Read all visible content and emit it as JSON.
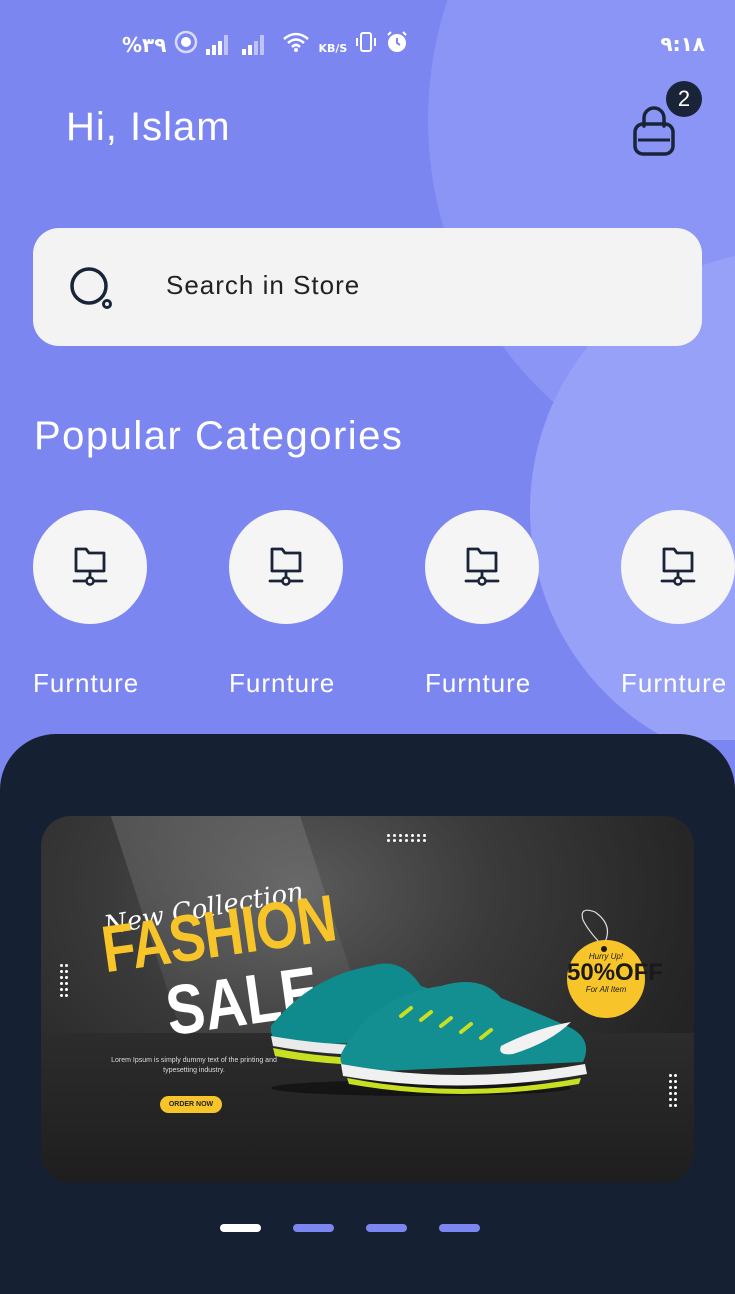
{
  "status_bar": {
    "battery": "%۳۹",
    "net_speed": "KB/S",
    "time": "۹:۱۸"
  },
  "header": {
    "greeting": "Hi, Islam",
    "cart_count": "2",
    "cart_icon": "shopping-bag-icon"
  },
  "search": {
    "placeholder": "Search in Store",
    "icon": "search-icon"
  },
  "categories": {
    "title": "Popular Categories",
    "items": [
      {
        "label": "Furnture",
        "icon": "folder-network-icon"
      },
      {
        "label": "Furnture",
        "icon": "folder-network-icon"
      },
      {
        "label": "Furnture",
        "icon": "folder-network-icon"
      },
      {
        "label": "Furnture",
        "icon": "folder-network-icon"
      }
    ]
  },
  "banner": {
    "script_text": "New Collection",
    "headline_1": "FASHION",
    "headline_2": "SALE",
    "body": "Lorem Ipsum is simply dummy text of the printing and typesetting industry.",
    "cta": "ORDER NOW",
    "tag_top": "Hurry Up!",
    "tag_discount": "50%OFF",
    "tag_bottom": "For All Item"
  },
  "carousel": {
    "page_count": 4,
    "active_index": 0
  },
  "colors": {
    "header_bg": "#7c86f0",
    "dark_panel": "#162033",
    "accent_yellow": "#f7c52a"
  }
}
